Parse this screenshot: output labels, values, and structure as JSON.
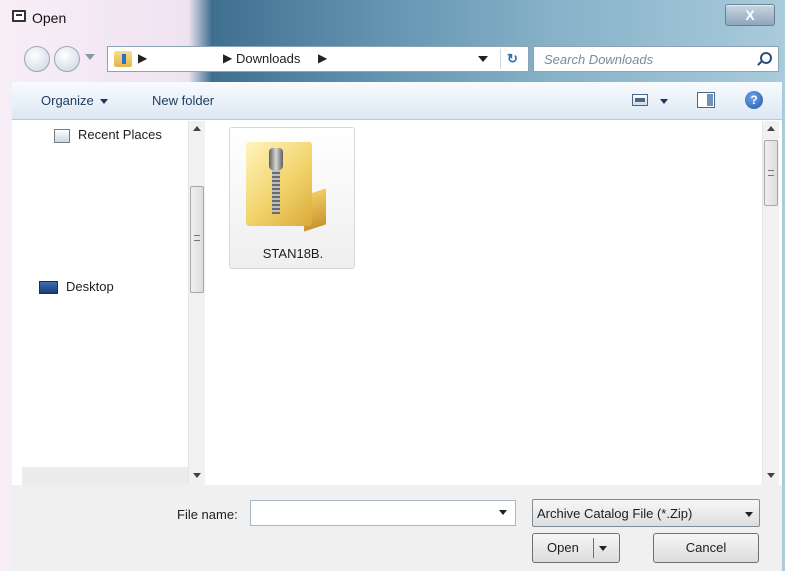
{
  "window": {
    "title": "Open",
    "close_glyph": "X"
  },
  "address_bar": {
    "folder": "Downloads",
    "separator": "▶",
    "search_placeholder": "Search Downloads",
    "refresh_glyph": "↻"
  },
  "toolbar": {
    "organize_label": "Organize",
    "new_folder_label": "New folder",
    "help_glyph": "?"
  },
  "nav_pane": {
    "items": [
      {
        "label": "Recent Places",
        "icon": "recent-places-icon"
      },
      {
        "label": "Desktop",
        "icon": "desktop-icon"
      }
    ]
  },
  "files": [
    {
      "name": "STAN18B.",
      "icon": "zip-folder-icon"
    }
  ],
  "bottom": {
    "file_name_label": "File name:",
    "file_name_value": "",
    "file_type": "Archive Catalog File (*.Zip)",
    "open_label": "Open",
    "cancel_label": "Cancel"
  },
  "colors": {
    "accent": "#1b3b5f",
    "glass": "#5d8fad"
  }
}
